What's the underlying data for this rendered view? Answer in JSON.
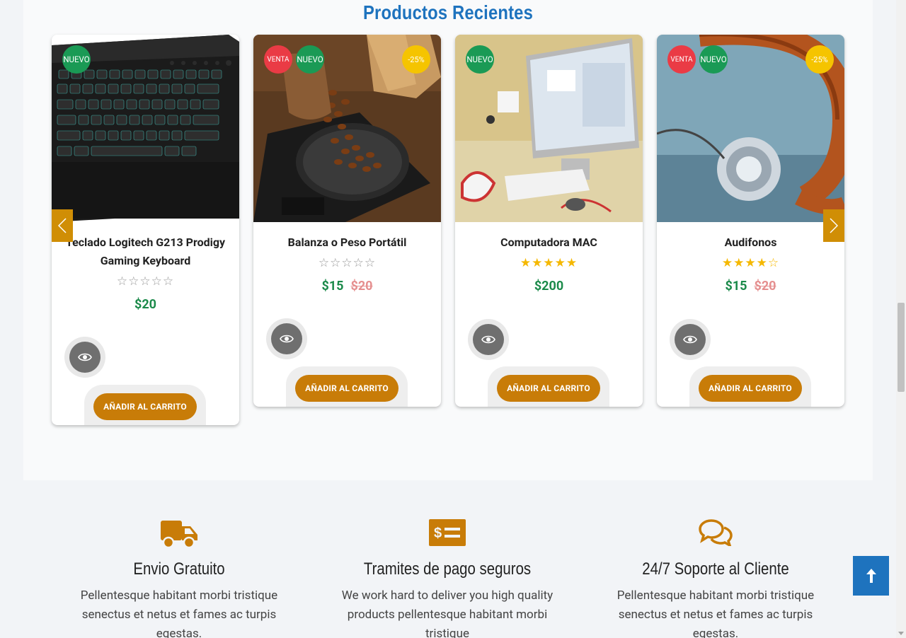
{
  "section_title": "Productos Recientes",
  "products": [
    {
      "name": "Teclado Logitech G213 Prodigy Gaming Keyboard",
      "badges": [
        "NUEVO"
      ],
      "rating_stars": "☆☆☆☆☆",
      "price": "$20",
      "old_price": "",
      "cart_label": "AÑADIR AL CARRITO"
    },
    {
      "name": "Balanza o Peso Portátil",
      "badges": [
        "VENTA",
        "NUEVO",
        "-25%"
      ],
      "rating_stars": "☆☆☆☆☆",
      "price": "$15",
      "old_price": "$20",
      "cart_label": "AÑADIR AL CARRITO"
    },
    {
      "name": "Computadora MAC",
      "badges": [
        "NUEVO"
      ],
      "rating_stars": "★★★★★",
      "price": "$200",
      "old_price": "",
      "cart_label": "AÑADIR AL CARRITO"
    },
    {
      "name": "Audifonos",
      "badges": [
        "VENTA",
        "NUEVO",
        "-25%"
      ],
      "rating_stars": "★★★★☆",
      "price": "$15",
      "old_price": "$20",
      "cart_label": "AÑADIR AL CARRITO"
    }
  ],
  "features": [
    {
      "icon": "truck-icon",
      "title": "Envio Gratuito",
      "text": "Pellentesque habitant morbi tristique senectus et netus et fames ac turpis egestas."
    },
    {
      "icon": "money-bill-icon",
      "title": "Tramites de pago seguros",
      "text": "We work hard to deliver you high quality products pellentesque habitant morbi tristique"
    },
    {
      "icon": "comments-icon",
      "title": "24/7 Soporte al Cliente",
      "text": "Pellentesque habitant morbi tristique senectus et netus et fames ac turpis egestas."
    }
  ],
  "colors": {
    "accent": "#c87c08",
    "title_blue": "#1e73be",
    "price_green": "#1b8a4a",
    "badge_new": "#1a9a55",
    "badge_sale": "#ea3b45",
    "badge_discount": "#f5c400"
  }
}
